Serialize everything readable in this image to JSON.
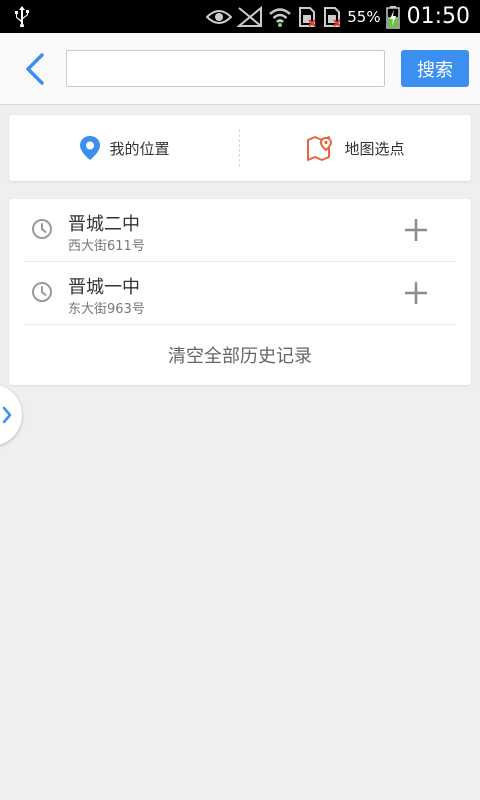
{
  "status_bar": {
    "battery_percent": "55%",
    "time": "01:50",
    "icons": [
      "usb-icon",
      "eye-icon",
      "no-signal-icon",
      "wifi-icon",
      "sim1-icon",
      "sim2-icon",
      "battery-charging-icon"
    ]
  },
  "header": {
    "search_value": "",
    "search_placeholder": "",
    "search_button": "搜索"
  },
  "location_options": {
    "my_location": "我的位置",
    "map_pick": "地图选点",
    "colors": {
      "my_location_pin": "#3a8ff0",
      "map_pick_icon": "#e8653f"
    }
  },
  "history": {
    "items": [
      {
        "title": "晋城二中",
        "address": "西大街611号"
      },
      {
        "title": "晋城一中",
        "address": "东大街963号"
      }
    ],
    "clear_label": "清空全部历史记录"
  },
  "colors": {
    "accent": "#3a8ff0",
    "background": "#efefef"
  }
}
